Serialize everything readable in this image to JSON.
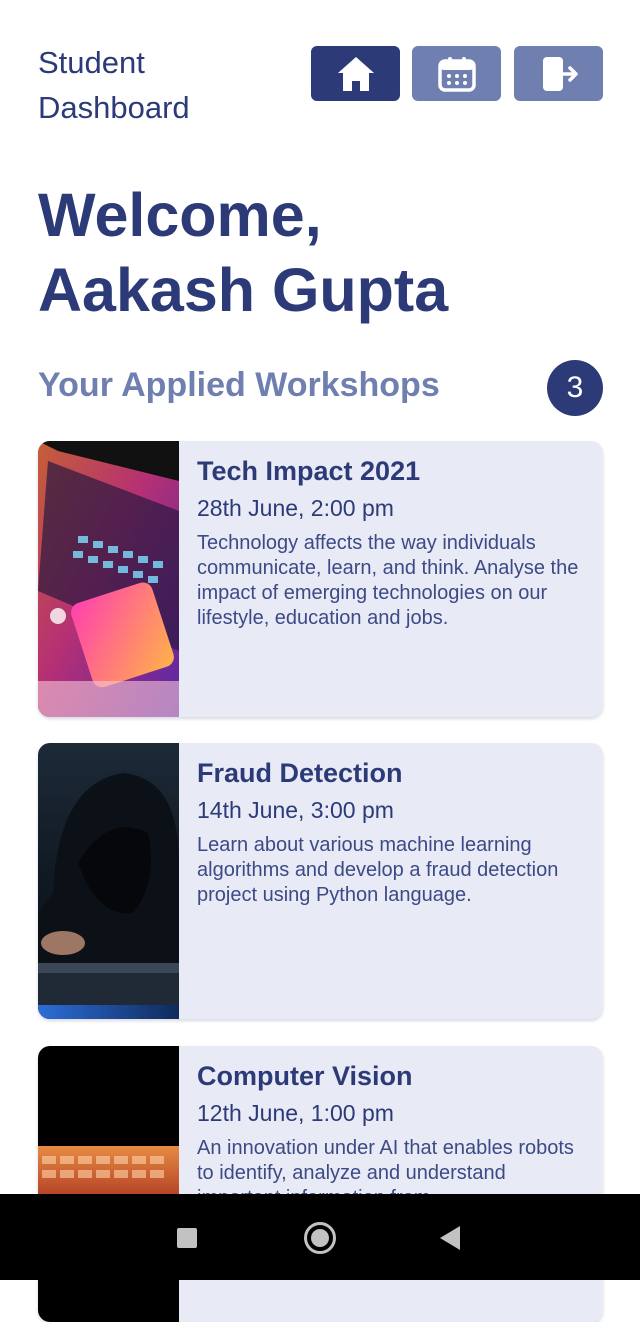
{
  "header": {
    "title": "Student Dashboard",
    "nav": [
      {
        "icon": "home-icon",
        "active": true
      },
      {
        "icon": "calendar-icon",
        "active": false
      },
      {
        "icon": "logout-icon",
        "active": false
      }
    ]
  },
  "welcome": {
    "greeting": "Welcome,",
    "name": "Aakash Gupta"
  },
  "workshops": {
    "heading": "Your Applied Workshops",
    "count": "3",
    "items": [
      {
        "title": "Tech Impact 2021",
        "date": "28th June, 2:00 pm",
        "description": "Technology affects the way individuals communicate, learn, and think. Analyse the impact of emerging technologies on our lifestyle, education and jobs.",
        "image": "laptop-phone-neon-photo"
      },
      {
        "title": "Fraud Detection",
        "date": "14th June, 3:00 pm",
        "description": "Learn about various machine learning algorithms and develop a fraud detection project using Python language.",
        "image": "hooded-hacker-photo"
      },
      {
        "title": "Computer Vision",
        "date": "12th June, 1:00 pm",
        "description": "An innovation under AI that enables robots to identify, analyze and understand important information from",
        "image": "keyboard-dark-photo"
      }
    ]
  },
  "system_nav": {
    "recents": "square-icon",
    "home": "circle-icon",
    "back": "triangle-back-icon"
  },
  "colors": {
    "primary": "#2c3b78",
    "secondary": "#6f7fb0",
    "card_bg": "#e8eaf6"
  }
}
